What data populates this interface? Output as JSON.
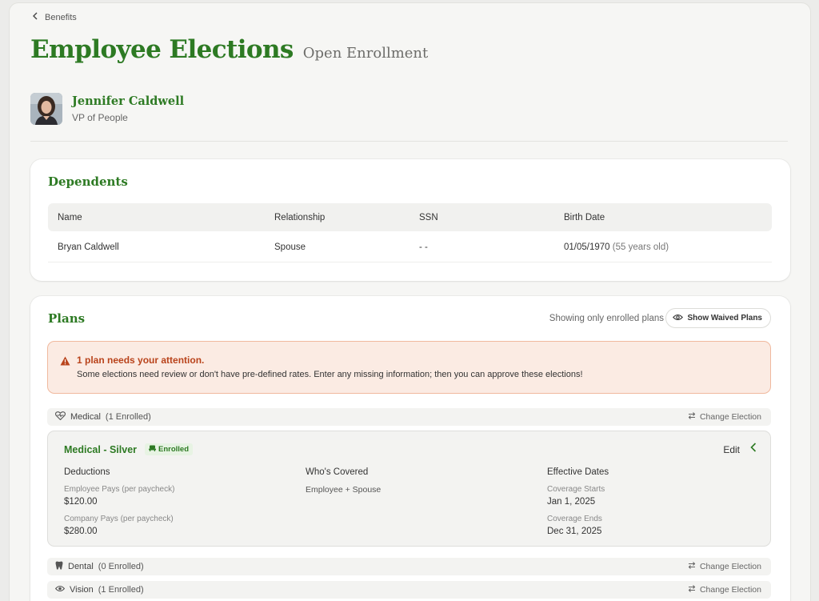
{
  "breadcrumb": {
    "label": "Benefits"
  },
  "header": {
    "title": "Employee Elections",
    "subtitle": "Open Enrollment"
  },
  "employee": {
    "name": "Jennifer Caldwell",
    "role": "VP of People"
  },
  "dependents": {
    "title": "Dependents",
    "columns": [
      "Name",
      "Relationship",
      "SSN",
      "Birth Date"
    ],
    "rows": [
      {
        "name": "Bryan Caldwell",
        "relationship": "Spouse",
        "ssn": "- -",
        "birth_date": "01/05/1970",
        "age": "(55 years old)"
      }
    ]
  },
  "plans": {
    "title": "Plans",
    "showing_text": "Showing only enrolled plans",
    "show_waived_label": "Show Waived Plans",
    "alert": {
      "title": "1 plan needs your attention.",
      "body": "Some elections need review or don't have pre-defined rates. Enter any missing information; then you can approve these elections!"
    },
    "categories": [
      {
        "name": "Medical",
        "count": "(1 Enrolled)",
        "action": "Change Election",
        "icon": "heart-pulse-icon"
      },
      {
        "name": "Dental",
        "count": "(0 Enrolled)",
        "action": "Change Election",
        "icon": "tooth-icon"
      },
      {
        "name": "Vision",
        "count": "(1 Enrolled)",
        "action": "Change Election",
        "icon": "eye-icon"
      }
    ],
    "medical_plan": {
      "name": "Medical - Silver",
      "badge": "Enrolled",
      "edit_label": "Edit",
      "deductions": {
        "heading": "Deductions",
        "employee_label": "Employee Pays (per paycheck)",
        "employee_value": "$120.00",
        "company_label": "Company Pays (per paycheck)",
        "company_value": "$280.00"
      },
      "covered": {
        "heading": "Who's Covered",
        "value": "Employee + Spouse"
      },
      "dates": {
        "heading": "Effective Dates",
        "start_label": "Coverage Starts",
        "start_value": "Jan 1, 2025",
        "end_label": "Coverage Ends",
        "end_value": "Dec 31, 2025"
      }
    }
  },
  "colors": {
    "brand_green": "#2d7a23",
    "alert_bg": "#fbebe3",
    "alert_text": "#b9431b"
  }
}
